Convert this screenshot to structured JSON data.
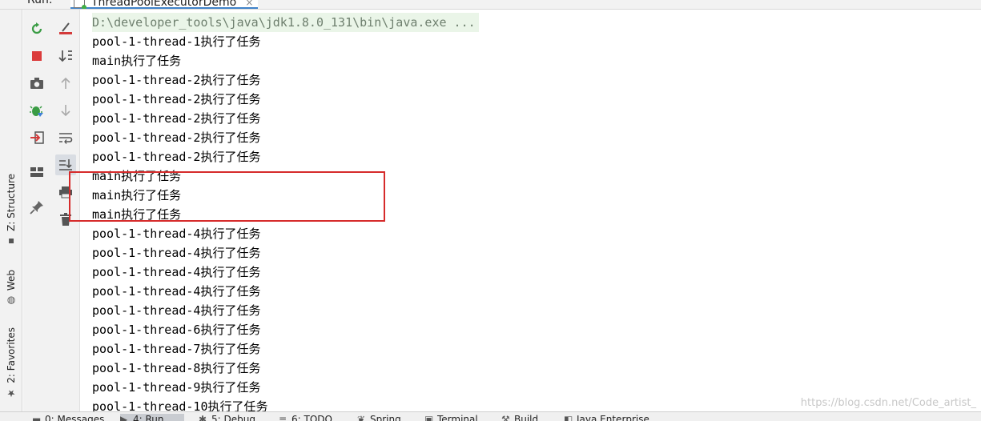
{
  "header": {
    "run_label": "Run:",
    "tab_name": "ThreadPoolExecutorDemo",
    "tab_close": "×"
  },
  "left_tabs": [
    {
      "label": "Z: Structure",
      "icon": "structure-icon"
    },
    {
      "label": "Web",
      "icon": "web-icon"
    },
    {
      "label": "2: Favorites",
      "icon": "star-icon"
    }
  ],
  "console": {
    "lines": [
      {
        "text": "D:\\developer_tools\\java\\jdk1.8.0_131\\bin\\java.exe ...",
        "kind": "cmd"
      },
      {
        "text": "pool-1-thread-1执行了任务"
      },
      {
        "text": "main执行了任务"
      },
      {
        "text": "pool-1-thread-2执行了任务"
      },
      {
        "text": "pool-1-thread-2执行了任务"
      },
      {
        "text": "pool-1-thread-2执行了任务"
      },
      {
        "text": "pool-1-thread-2执行了任务"
      },
      {
        "text": "pool-1-thread-2执行了任务"
      },
      {
        "text": "main执行了任务"
      },
      {
        "text": "main执行了任务"
      },
      {
        "text": "main执行了任务"
      },
      {
        "text": "pool-1-thread-4执行了任务"
      },
      {
        "text": "pool-1-thread-4执行了任务"
      },
      {
        "text": "pool-1-thread-4执行了任务"
      },
      {
        "text": "pool-1-thread-4执行了任务"
      },
      {
        "text": "pool-1-thread-4执行了任务"
      },
      {
        "text": "pool-1-thread-6执行了任务"
      },
      {
        "text": "pool-1-thread-7执行了任务"
      },
      {
        "text": "pool-1-thread-8执行了任务"
      },
      {
        "text": "pool-1-thread-9执行了任务"
      },
      {
        "text": "pool-1-thread-10执行了任务"
      }
    ]
  },
  "bottom_tabs": [
    {
      "label": "0: Messages",
      "icon": "messages-icon"
    },
    {
      "label": "4: Run",
      "icon": "run-icon",
      "active": true
    },
    {
      "label": "5: Debug",
      "icon": "debug-icon"
    },
    {
      "label": "6: TODO",
      "icon": "todo-icon"
    },
    {
      "label": "Spring",
      "icon": "spring-icon"
    },
    {
      "label": "Terminal",
      "icon": "terminal-icon"
    },
    {
      "label": "Build",
      "icon": "build-icon"
    },
    {
      "label": "Java Enterprise",
      "icon": "java-enterprise-icon"
    }
  ],
  "watermark": "https://blog.csdn.net/Code_artist_",
  "colors": {
    "highlight_box": "#d62b2b",
    "active_tab_underline": "#4083c9",
    "command_line_bg": "#eaf5e8"
  }
}
